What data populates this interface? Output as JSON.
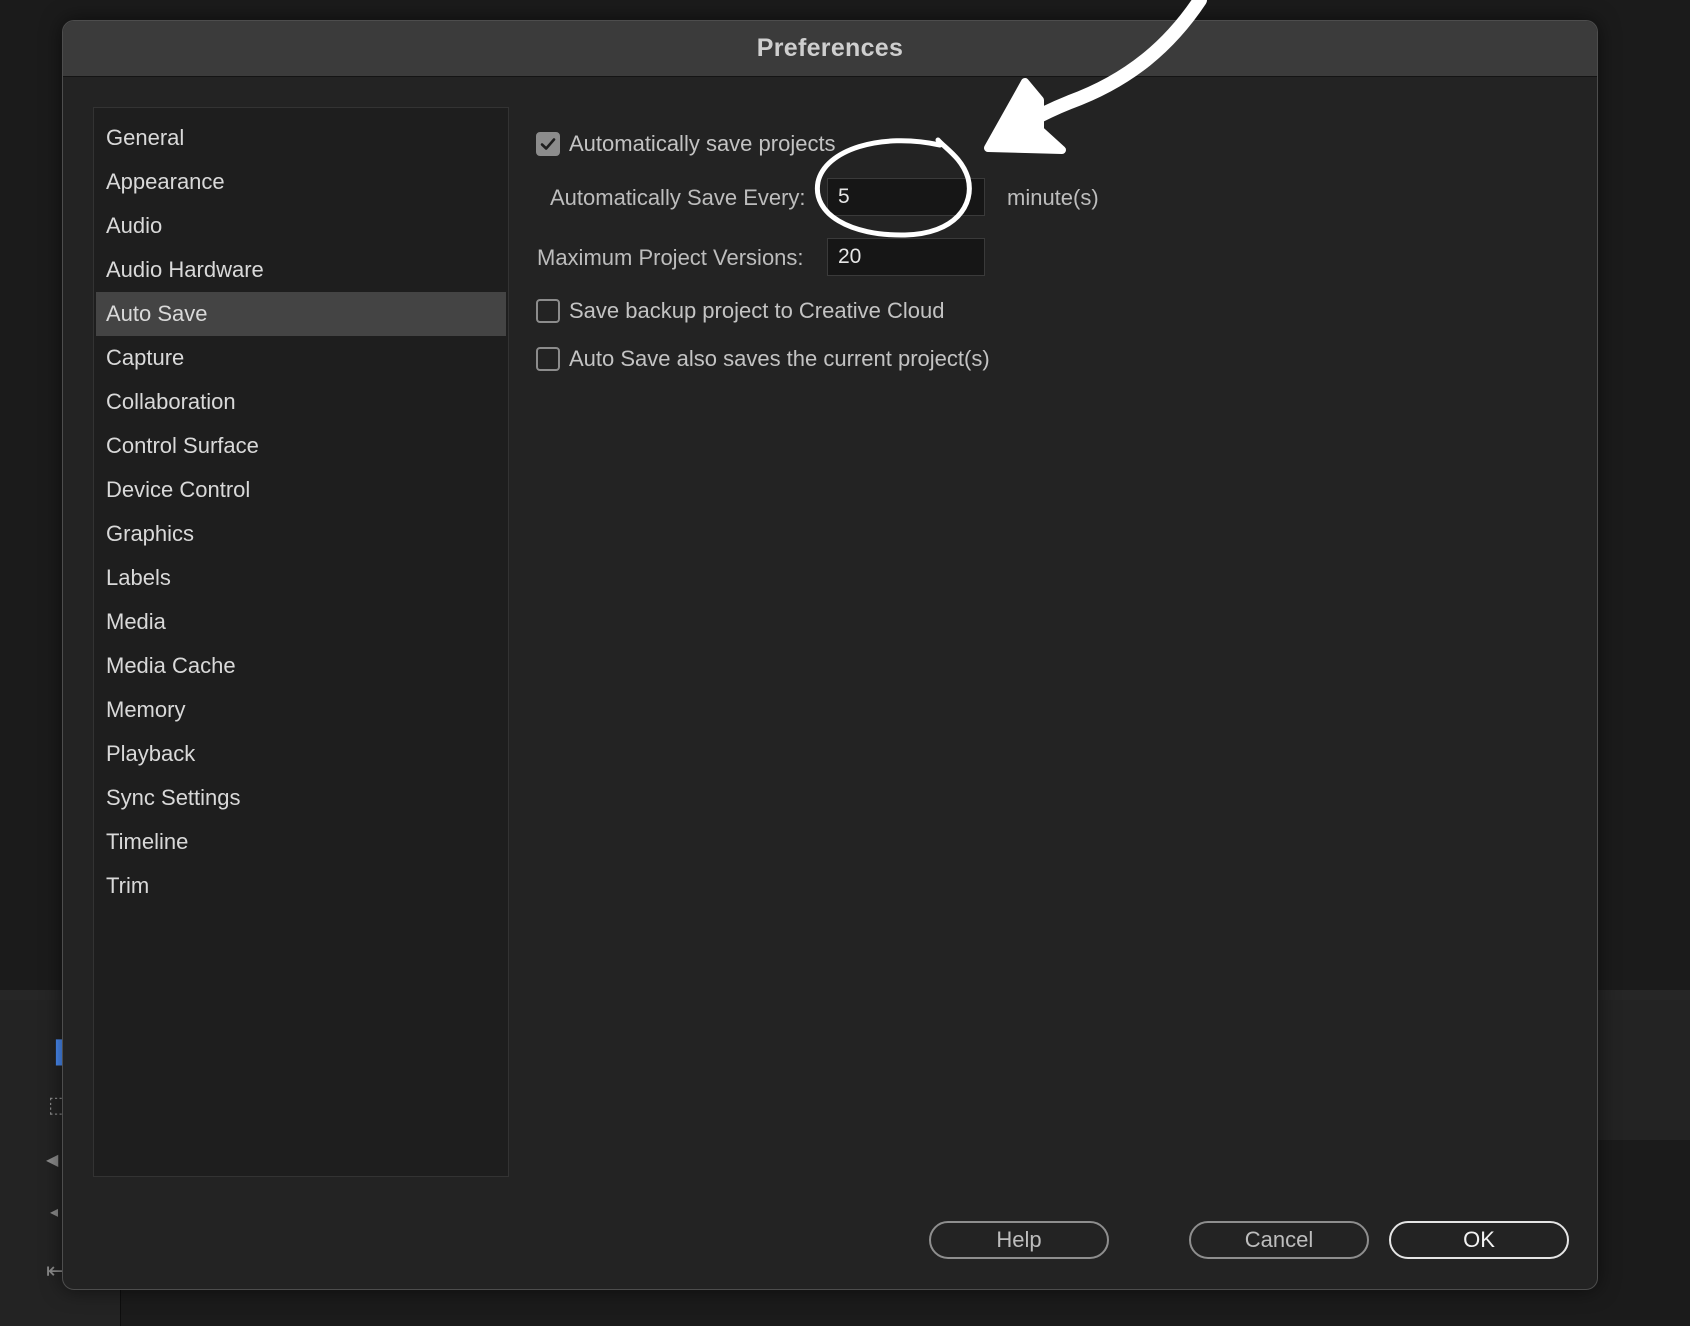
{
  "dialog": {
    "title": "Preferences"
  },
  "sidebar": {
    "items": [
      {
        "label": "General",
        "selected": false
      },
      {
        "label": "Appearance",
        "selected": false
      },
      {
        "label": "Audio",
        "selected": false
      },
      {
        "label": "Audio Hardware",
        "selected": false
      },
      {
        "label": "Auto Save",
        "selected": true
      },
      {
        "label": "Capture",
        "selected": false
      },
      {
        "label": "Collaboration",
        "selected": false
      },
      {
        "label": "Control Surface",
        "selected": false
      },
      {
        "label": "Device Control",
        "selected": false
      },
      {
        "label": "Graphics",
        "selected": false
      },
      {
        "label": "Labels",
        "selected": false
      },
      {
        "label": "Media",
        "selected": false
      },
      {
        "label": "Media Cache",
        "selected": false
      },
      {
        "label": "Memory",
        "selected": false
      },
      {
        "label": "Playback",
        "selected": false
      },
      {
        "label": "Sync Settings",
        "selected": false
      },
      {
        "label": "Timeline",
        "selected": false
      },
      {
        "label": "Trim",
        "selected": false
      }
    ]
  },
  "autosave": {
    "auto_save_projects": {
      "label": "Automatically save projects",
      "checked": true
    },
    "save_every": {
      "label": "Automatically Save Every:",
      "value": "5",
      "unit": "minute(s)"
    },
    "max_versions": {
      "label": "Maximum Project Versions:",
      "value": "20"
    },
    "backup_cloud": {
      "label": "Save backup project to Creative Cloud",
      "checked": false
    },
    "also_saves_current": {
      "label": "Auto Save also saves the current project(s)",
      "checked": false
    }
  },
  "buttons": {
    "help": "Help",
    "cancel": "Cancel",
    "ok": "OK"
  },
  "colors": {
    "accent_checkbox": "#8c8c8c",
    "annotation": "#ffffff",
    "selected_row": "#444444"
  }
}
